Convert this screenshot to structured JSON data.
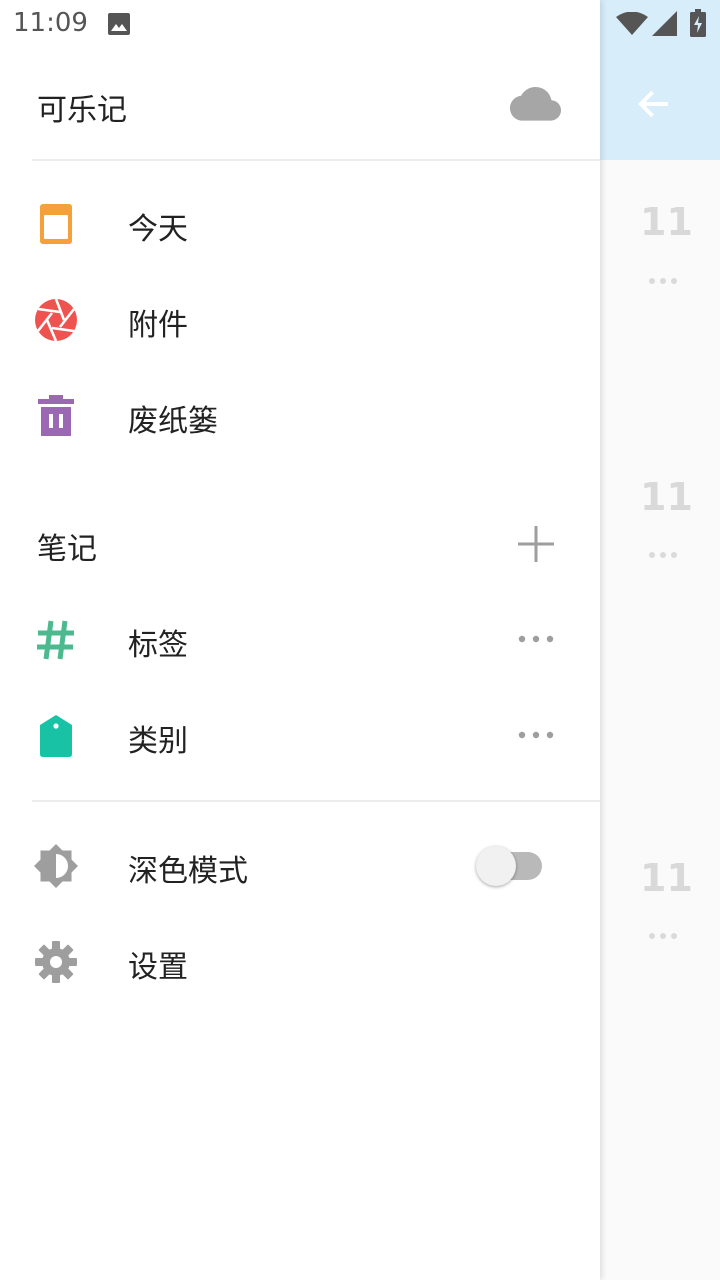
{
  "status_bar": {
    "time": "11:09"
  },
  "drawer": {
    "title": "可乐记",
    "items": [
      {
        "label": "今天",
        "icon": "calendar-today-icon",
        "color": "#f5a03b"
      },
      {
        "label": "附件",
        "icon": "camera-aperture-icon",
        "color": "#ee5350"
      },
      {
        "label": "废纸篓",
        "icon": "trash-icon",
        "color": "#9b68b3"
      }
    ],
    "notes_section": {
      "title": "笔记",
      "items": [
        {
          "label": "标签",
          "icon": "hashtag-icon",
          "color": "#4cb98f"
        },
        {
          "label": "类别",
          "icon": "tag-icon",
          "color": "#18c3a5"
        }
      ]
    },
    "dark_mode": {
      "label": "深色模式",
      "enabled": false
    },
    "settings": {
      "label": "设置"
    }
  },
  "background": {
    "numbers": [
      "11",
      "11",
      "11"
    ]
  }
}
